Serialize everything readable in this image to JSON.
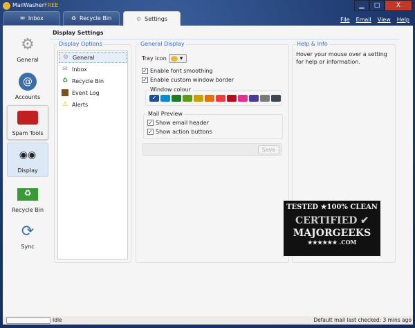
{
  "app": {
    "title_main": "MailWasher",
    "title_suffix": "FREE",
    "min": "▁",
    "max": "□",
    "close": "X"
  },
  "tabs": [
    {
      "label": "Inbox",
      "icon": "envelope-icon"
    },
    {
      "label": "Recycle Bin",
      "icon": "recycle-icon"
    },
    {
      "label": "Settings",
      "icon": "gear-icon",
      "active": true
    }
  ],
  "menu": [
    "File",
    "Email",
    "View",
    "Help"
  ],
  "sidebar": [
    {
      "label": "General",
      "icon": "gear-icon"
    },
    {
      "label": "Accounts",
      "icon": "at-icon"
    },
    {
      "label": "Spam Tools",
      "icon": "toolbox-icon"
    },
    {
      "label": "Display",
      "icon": "glasses-icon",
      "selected": true
    },
    {
      "label": "Recycle Bin",
      "icon": "recycle-bin-icon"
    },
    {
      "label": "Sync",
      "icon": "sync-icon"
    }
  ],
  "page_title": "Display Settings",
  "display_options": {
    "title": "Display Options",
    "items": [
      {
        "label": "General",
        "icon": "gear-icon",
        "selected": true
      },
      {
        "label": "Inbox",
        "icon": "envelope-icon"
      },
      {
        "label": "Recycle Bin",
        "icon": "recycle-icon"
      },
      {
        "label": "Event Log",
        "icon": "book-icon"
      },
      {
        "label": "Alerts",
        "icon": "warning-icon"
      }
    ]
  },
  "general_display": {
    "title": "General Display",
    "tray_icon_label": "Tray icon",
    "font_smoothing": "Enable font smoothing",
    "custom_border": "Enable custom window border",
    "window_colour_label": "Window colour",
    "colours": [
      "#1f4e99",
      "#0a8ad0",
      "#1f7a2a",
      "#5e9a1e",
      "#c9a008",
      "#e07010",
      "#e84040",
      "#b0101c",
      "#e03090",
      "#4a3a9a",
      "#7a7a7a",
      "#3e4450"
    ],
    "selected_colour": "#1f4e99",
    "mail_preview_label": "Mail Preview",
    "show_header": "Show email header",
    "show_buttons": "Show action buttons",
    "save": "Save"
  },
  "help": {
    "title": "Help & Info",
    "text": "Hover your mouse over a setting for help or information."
  },
  "status": {
    "state": "Idle",
    "last_checked": "Default mail last checked: 3 mins ago",
    "progress": 0
  },
  "watermark": {
    "line1": "TESTED ★100% CLEAN",
    "line2": "CERTIFIED",
    "line3": "MAJORGEEKS",
    "line4": "★★★★★★ .COM"
  }
}
